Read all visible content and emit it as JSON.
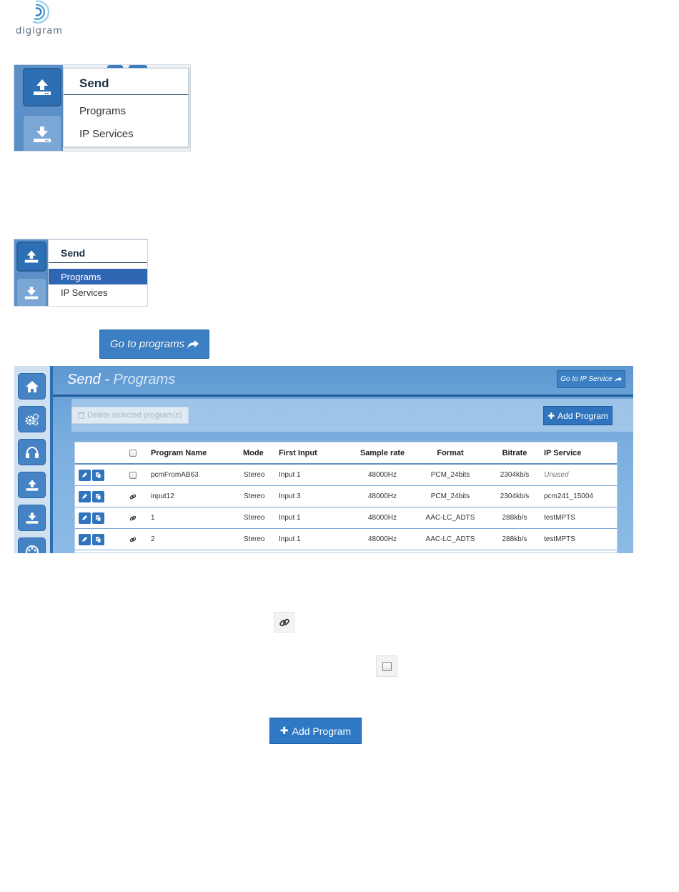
{
  "logo": {
    "text": "digigram"
  },
  "menu1": {
    "header": "Send",
    "items": [
      "Programs",
      "IP Services"
    ]
  },
  "menu2": {
    "header": "Send",
    "items": [
      "Programs",
      "IP Services"
    ],
    "selected": "Programs"
  },
  "goto_programs_button": "Go to programs",
  "app": {
    "title_main": "Send",
    "title_sep": " - ",
    "title_sub": "Programs",
    "go_ip_button": "Go to IP Service",
    "delete_button": "Delete selected program(s)",
    "add_button": "Add Program",
    "table": {
      "headers": [
        "",
        "",
        "Program Name",
        "Mode",
        "First Input",
        "Sample rate",
        "Format",
        "Bitrate",
        "IP Service"
      ],
      "rows": [
        {
          "linked": false,
          "name": "pcmFromAB63",
          "mode": "Stereo",
          "input": "Input 1",
          "rate": "48000Hz",
          "format": "PCM_24bits",
          "bitrate": "2304kb/s",
          "service": "Unused"
        },
        {
          "linked": true,
          "name": "input12",
          "mode": "Stereo",
          "input": "Input 3",
          "rate": "48000Hz",
          "format": "PCM_24bits",
          "bitrate": "2304kb/s",
          "service": "pcm241_15004"
        },
        {
          "linked": true,
          "name": "1",
          "mode": "Stereo",
          "input": "Input 1",
          "rate": "48000Hz",
          "format": "AAC-LC_ADTS",
          "bitrate": "288kb/s",
          "service": "testMPTS"
        },
        {
          "linked": true,
          "name": "2",
          "mode": "Stereo",
          "input": "Input 1",
          "rate": "48000Hz",
          "format": "AAC-LC_ADTS",
          "bitrate": "288kb/s",
          "service": "testMPTS"
        }
      ]
    },
    "sidebar_icons": [
      "home-icon",
      "settings-icon",
      "headphones-icon",
      "upload-icon",
      "download-icon",
      "network-icon"
    ]
  },
  "add_program_button": "Add Program",
  "colors": {
    "primary": "#2f74bd",
    "selected_menu": "#2f66b3",
    "sidebar": "#cfe0f1"
  }
}
